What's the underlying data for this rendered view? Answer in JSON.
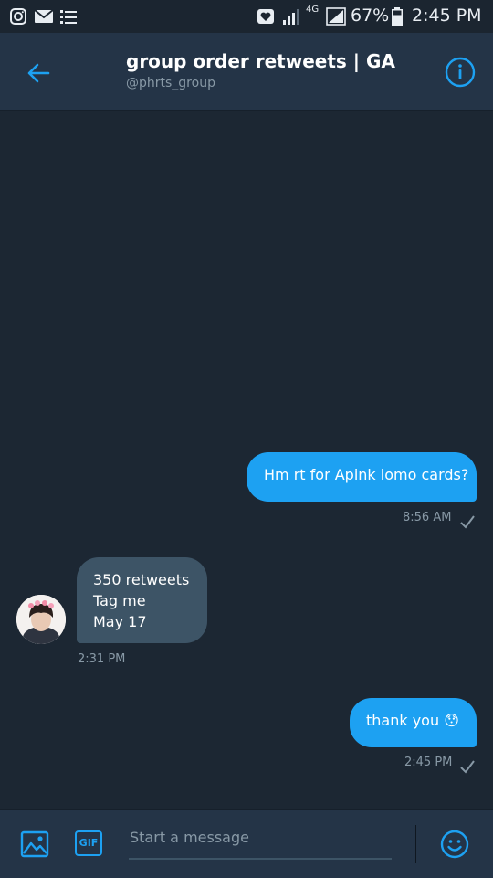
{
  "status_bar": {
    "battery": "67%",
    "time": "2:45 PM",
    "network": "4G",
    "icons": [
      "instagram-icon",
      "mail-icon",
      "list-icon",
      "heart-box-icon",
      "signal-icon",
      "4g-icon",
      "signal-box-icon",
      "battery-icon"
    ]
  },
  "header": {
    "title": "group order retweets | GA",
    "handle": "@phrts_group",
    "back_icon": "back-arrow-icon",
    "info_icon": "info-icon"
  },
  "messages": [
    {
      "direction": "outgoing",
      "text": "Hm rt for Apink lomo cards?",
      "time": "8:56 AM",
      "read_check": true
    },
    {
      "direction": "incoming",
      "lines": [
        "350 retweets",
        "Tag me",
        "May 17"
      ],
      "time": "2:31 PM"
    },
    {
      "direction": "outgoing",
      "text": "thank you 😯",
      "time": "2:45 PM",
      "read_check": true
    }
  ],
  "composer": {
    "placeholder": "Start a message",
    "gif_label": "GIF",
    "icons": [
      "image-icon",
      "gif-icon",
      "emoji-icon"
    ]
  },
  "colors": {
    "background": "#1c2733",
    "header": "#243447",
    "accent": "#1da1f2",
    "incoming_bubble": "#3d5466",
    "muted_text": "#8899a6"
  }
}
